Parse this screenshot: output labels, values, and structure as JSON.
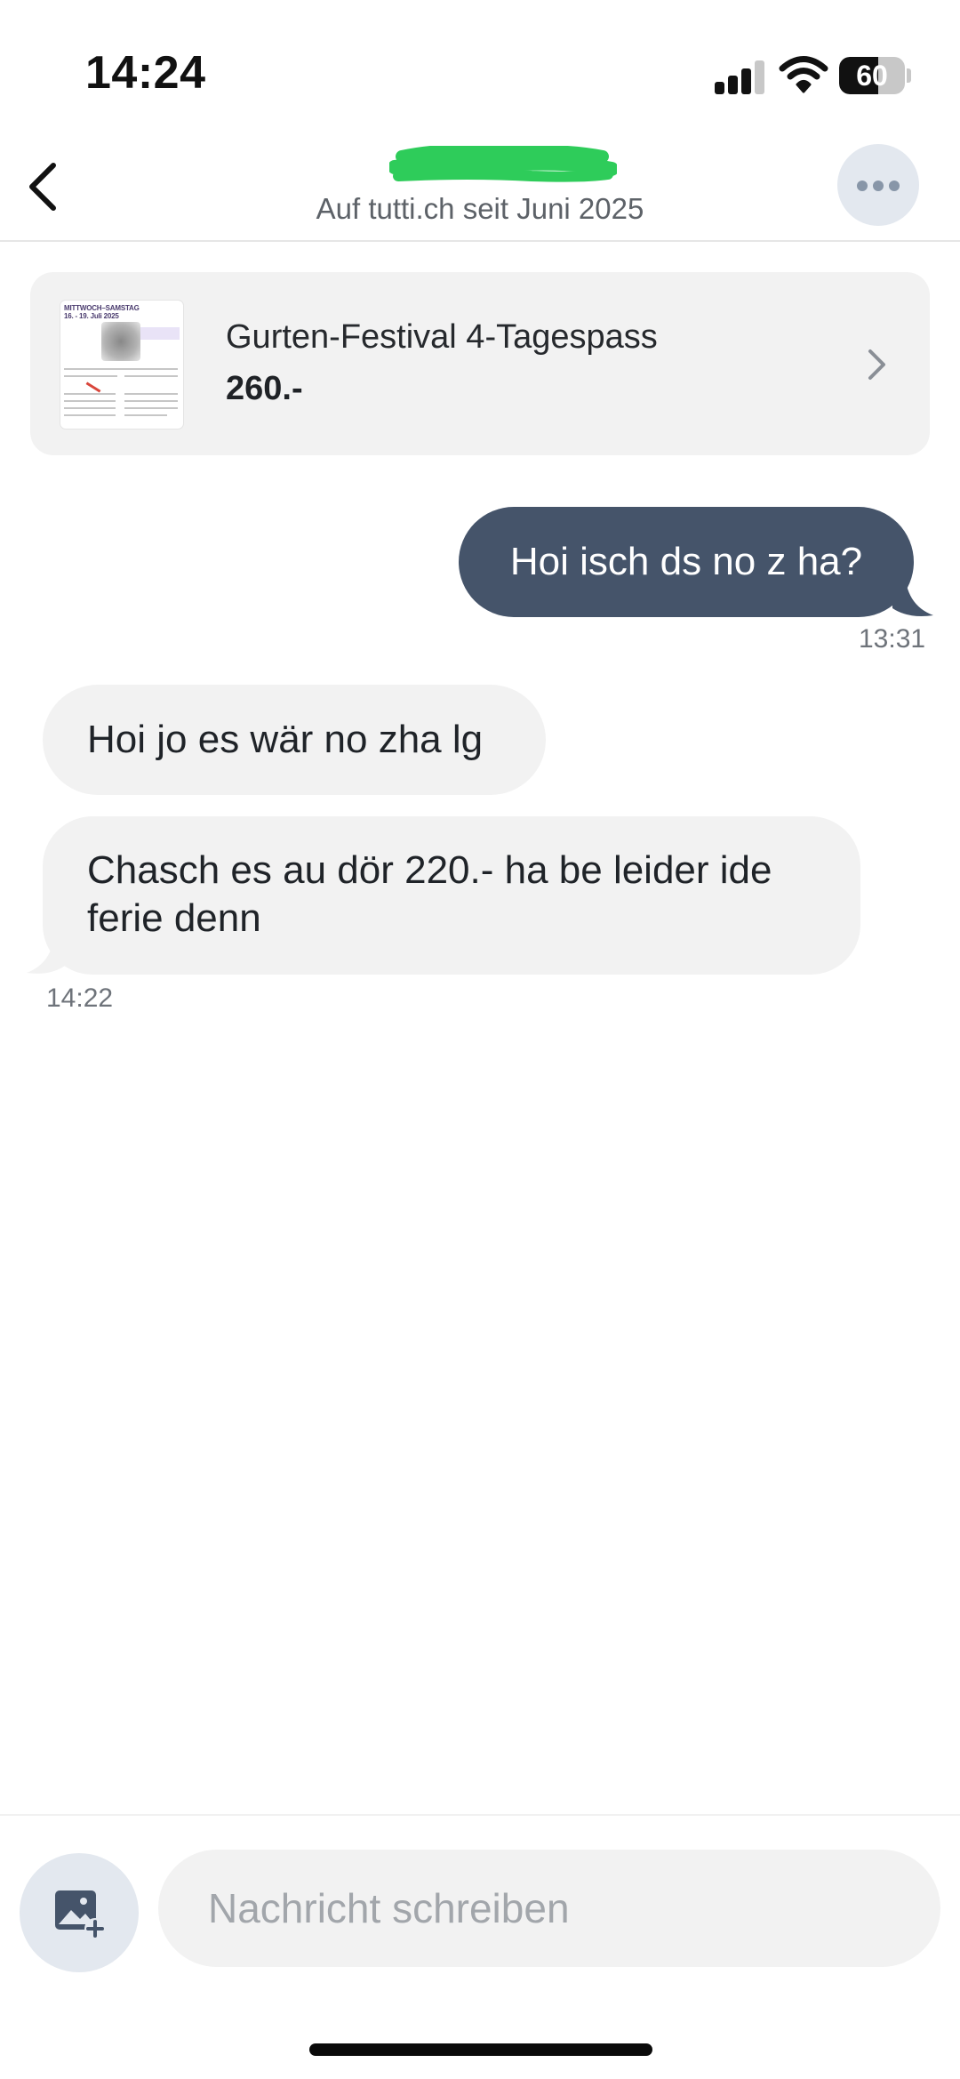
{
  "status_bar": {
    "time": "14:24",
    "battery": "60",
    "battery_level": 0.6
  },
  "header": {
    "subtitle": "Auf tutti.ch seit Juni 2025",
    "name_redaction_color": "#2ecc5a"
  },
  "listing": {
    "title": "Gurten-Festival 4-Tagespass",
    "price": "260.-",
    "thumbnail_text_line1": "MITTWOCH–SAMSTAG",
    "thumbnail_text_line2": "16. - 19. Juli 2025"
  },
  "messages": [
    {
      "direction": "outgoing",
      "text": "Hoi isch ds no z ha?",
      "time": "13:31"
    },
    {
      "direction": "incoming",
      "text": "Hoi jo es wär no zha lg"
    },
    {
      "direction": "incoming",
      "text": "Chasch es au dör 220.- ha be leider ide ferie denn",
      "time": "14:22"
    }
  ],
  "composer": {
    "placeholder": "Nachricht schreiben"
  },
  "colors": {
    "outgoing_bubble": "#45546a",
    "incoming_bubble": "#f2f2f2",
    "icon_button_bg": "#e3e8ef"
  }
}
